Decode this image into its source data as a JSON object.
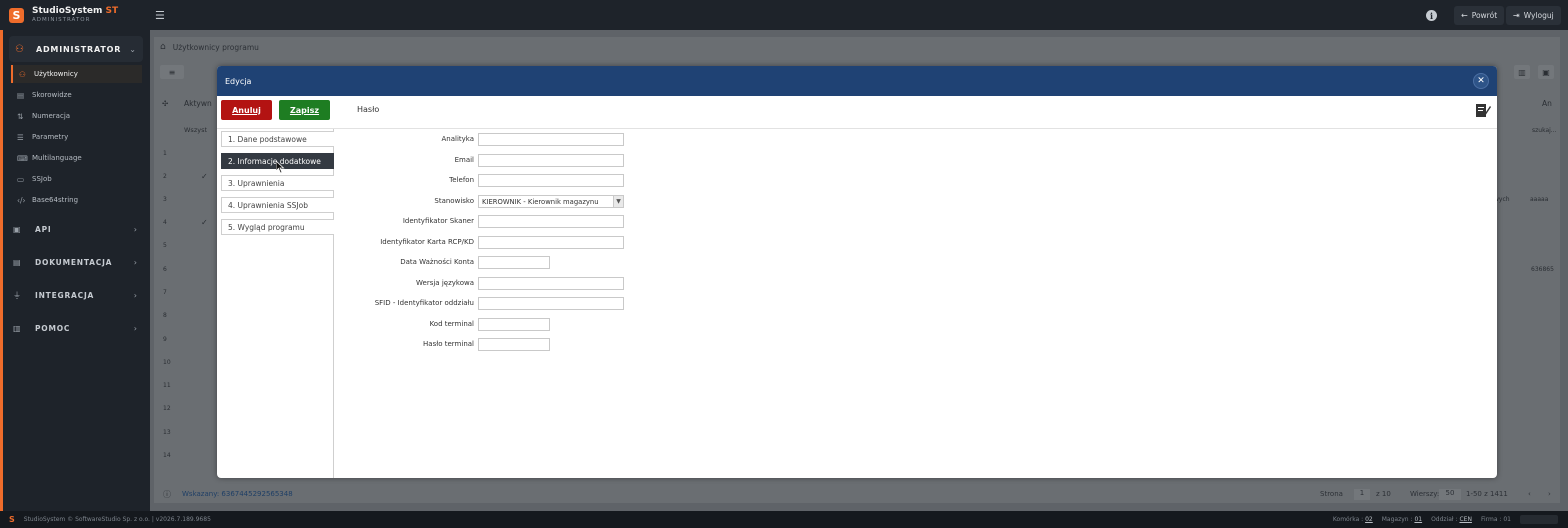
{
  "app": {
    "logo_letter": "S",
    "name": "StudioSystem",
    "name_accent": "ST",
    "subtitle": "ADMINISTRATOR",
    "accent_color": "#ef6c2b"
  },
  "topbar": {
    "menu_icon": "menu-toggle-icon",
    "info_icon": "info-icon",
    "back_label": "Powrót",
    "logout_label": "Wyloguj"
  },
  "sidebar": {
    "admin_section": "ADMINISTRATOR",
    "items": [
      {
        "label": "Użytkownicy",
        "icon": "users-icon",
        "active": true
      },
      {
        "label": "Skorowidze",
        "icon": "table-icon"
      },
      {
        "label": "Numeracja",
        "icon": "sort-icon"
      },
      {
        "label": "Parametry",
        "icon": "sliders-icon"
      },
      {
        "label": "Multilanguage",
        "icon": "keyboard-icon"
      },
      {
        "label": "SSJob",
        "icon": "terminal-icon"
      },
      {
        "label": "Base64string",
        "icon": "code-icon"
      }
    ],
    "sections": [
      {
        "label": "API",
        "icon": "box-icon"
      },
      {
        "label": "DOKUMENTACJA",
        "icon": "book-icon"
      },
      {
        "label": "INTEGRACJA",
        "icon": "plug-icon"
      },
      {
        "label": "POMOC",
        "icon": "help-book-icon"
      }
    ]
  },
  "background": {
    "breadcrumb": "Użytkownicy programu",
    "column_aktywny": "Aktywn",
    "filter_placeholder": "Wszyst",
    "column_right": "An",
    "filter_right": "szukaj...",
    "row_numbers": [
      "1",
      "2",
      "3",
      "4",
      "5",
      "6",
      "7",
      "8",
      "9",
      "10",
      "11",
      "12",
      "13",
      "14"
    ],
    "text_wych": "wych",
    "text_aaaaa": "aaaaa",
    "text_636": "636865",
    "footer_count": "Wskazany: 6367445292565348",
    "footer_page_label": "Strona",
    "footer_page": "1",
    "footer_of": "z 10",
    "footer_rows_label": "Wierszy:",
    "footer_rows": "50",
    "footer_range": "1-50 z 1411"
  },
  "modal": {
    "title": "Edycja",
    "cancel_label": "Anuluj",
    "save_label": "Zapisz",
    "password_label": "Hasło",
    "tabs": [
      "1. Dane podstawowe",
      "2. Informacje dodatkowe",
      "3. Uprawnienia",
      "4. Uprawnienia SSJob",
      "5. Wygląd programu"
    ],
    "active_tab": 1,
    "fields": [
      {
        "label": "Analityka",
        "value": ""
      },
      {
        "label": "Email",
        "value": ""
      },
      {
        "label": "Telefon",
        "value": ""
      },
      {
        "label": "Stanowisko",
        "value": "KIEROWNIK - Kierownik magazynu"
      },
      {
        "label": "Identyfikator Skaner",
        "value": ""
      },
      {
        "label": "Identyfikator Karta RCP/KD",
        "value": ""
      },
      {
        "label": "Data Ważności Konta",
        "value": ""
      },
      {
        "label": "Wersja językowa",
        "value": ""
      },
      {
        "label": "SFID - Identyfikator oddziału",
        "value": ""
      },
      {
        "label": "Kod terminal",
        "value": ""
      },
      {
        "label": "Hasło terminal",
        "value": ""
      }
    ]
  },
  "statusbar": {
    "logo_letter": "S",
    "copyright": "StudioSystem © SoftwareStudio Sp. z o.o. | v2026.7.189.9685",
    "komorka_label": "Komórka :",
    "komorka_value": "02",
    "magazyn_label": "Magazyn :",
    "magazyn_value": "01",
    "oddzial_label": "Oddział :",
    "oddzial_value": "CEN",
    "firma_label": "Firma :",
    "firma_value": "01"
  }
}
